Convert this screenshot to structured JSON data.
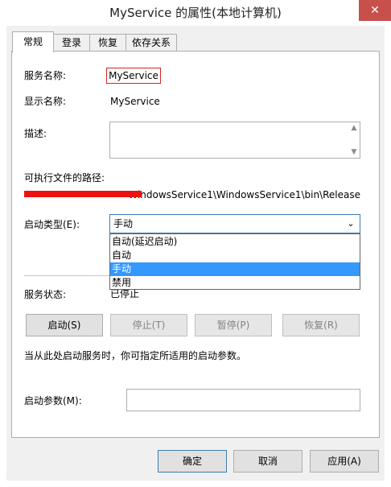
{
  "window": {
    "title": "MyService 的属性(本地计算机)",
    "close_glyph": "✕"
  },
  "tabs": [
    {
      "label": "常规",
      "active": true
    },
    {
      "label": "登录",
      "active": false
    },
    {
      "label": "恢复",
      "active": false
    },
    {
      "label": "依存关系",
      "active": false
    }
  ],
  "general": {
    "service_name_label": "服务名称:",
    "service_name": "MyService",
    "display_name_label": "显示名称:",
    "display_name": "MyService",
    "description_label": "描述:",
    "description": "",
    "exe_path_label": "可执行文件的路径:",
    "exe_path": "WindowsService1\\WindowsService1\\bin\\Release",
    "startup_type_label": "启动类型(E):",
    "startup_type": "手动",
    "startup_options": [
      "自动(延迟启动)",
      "自动",
      "手动",
      "禁用"
    ],
    "startup_selected_index": 2,
    "status_label": "服务状态:",
    "status": "已停止",
    "hint": "当从此处启动服务时，你可指定所适用的启动参数。",
    "start_params_label": "启动参数(M):",
    "start_params": ""
  },
  "service_buttons": {
    "start": "启动(S)",
    "stop": "停止(T)",
    "pause": "暂停(P)",
    "resume": "恢复(R)"
  },
  "dialog_buttons": {
    "ok": "确定",
    "cancel": "取消",
    "apply": "应用(A)"
  },
  "colors": {
    "selection": "#3399ff",
    "close_button": "#c7504b",
    "redaction": "#ee1111",
    "focus_border": "#3c7fb1"
  }
}
